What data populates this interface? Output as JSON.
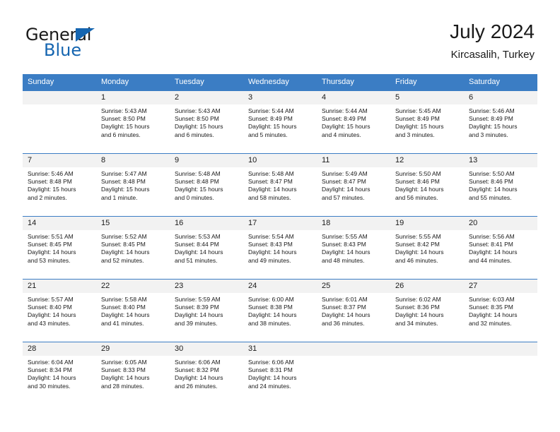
{
  "brand": {
    "word_top": "General",
    "word_bottom": "Blue",
    "triangle_color": "#1565b0",
    "blue_color": "#1565b0"
  },
  "header": {
    "title": "July 2024",
    "subtitle": "Kircasalih, Turkey"
  },
  "theme": {
    "header_bg": "#3b7dc4",
    "header_text": "#ffffff",
    "daynum_bg": "#f2f2f2",
    "row_rule": "#3b7dc4",
    "body_text": "#1a1a1a"
  },
  "weekday_headers": [
    "Sunday",
    "Monday",
    "Tuesday",
    "Wednesday",
    "Thursday",
    "Friday",
    "Saturday"
  ],
  "calendar_data": {
    "type": "table",
    "title": "July 2024",
    "location": "Kircasalih, Turkey",
    "weeks": [
      [
        {
          "day": "",
          "sunrise": "",
          "sunset": "",
          "daylight_line1": "",
          "daylight_line2": ""
        },
        {
          "day": "1",
          "sunrise": "Sunrise: 5:43 AM",
          "sunset": "Sunset: 8:50 PM",
          "daylight_line1": "Daylight: 15 hours",
          "daylight_line2": "and 6 minutes."
        },
        {
          "day": "2",
          "sunrise": "Sunrise: 5:43 AM",
          "sunset": "Sunset: 8:50 PM",
          "daylight_line1": "Daylight: 15 hours",
          "daylight_line2": "and 6 minutes."
        },
        {
          "day": "3",
          "sunrise": "Sunrise: 5:44 AM",
          "sunset": "Sunset: 8:49 PM",
          "daylight_line1": "Daylight: 15 hours",
          "daylight_line2": "and 5 minutes."
        },
        {
          "day": "4",
          "sunrise": "Sunrise: 5:44 AM",
          "sunset": "Sunset: 8:49 PM",
          "daylight_line1": "Daylight: 15 hours",
          "daylight_line2": "and 4 minutes."
        },
        {
          "day": "5",
          "sunrise": "Sunrise: 5:45 AM",
          "sunset": "Sunset: 8:49 PM",
          "daylight_line1": "Daylight: 15 hours",
          "daylight_line2": "and 3 minutes."
        },
        {
          "day": "6",
          "sunrise": "Sunrise: 5:46 AM",
          "sunset": "Sunset: 8:49 PM",
          "daylight_line1": "Daylight: 15 hours",
          "daylight_line2": "and 3 minutes."
        }
      ],
      [
        {
          "day": "7",
          "sunrise": "Sunrise: 5:46 AM",
          "sunset": "Sunset: 8:48 PM",
          "daylight_line1": "Daylight: 15 hours",
          "daylight_line2": "and 2 minutes."
        },
        {
          "day": "8",
          "sunrise": "Sunrise: 5:47 AM",
          "sunset": "Sunset: 8:48 PM",
          "daylight_line1": "Daylight: 15 hours",
          "daylight_line2": "and 1 minute."
        },
        {
          "day": "9",
          "sunrise": "Sunrise: 5:48 AM",
          "sunset": "Sunset: 8:48 PM",
          "daylight_line1": "Daylight: 15 hours",
          "daylight_line2": "and 0 minutes."
        },
        {
          "day": "10",
          "sunrise": "Sunrise: 5:48 AM",
          "sunset": "Sunset: 8:47 PM",
          "daylight_line1": "Daylight: 14 hours",
          "daylight_line2": "and 58 minutes."
        },
        {
          "day": "11",
          "sunrise": "Sunrise: 5:49 AM",
          "sunset": "Sunset: 8:47 PM",
          "daylight_line1": "Daylight: 14 hours",
          "daylight_line2": "and 57 minutes."
        },
        {
          "day": "12",
          "sunrise": "Sunrise: 5:50 AM",
          "sunset": "Sunset: 8:46 PM",
          "daylight_line1": "Daylight: 14 hours",
          "daylight_line2": "and 56 minutes."
        },
        {
          "day": "13",
          "sunrise": "Sunrise: 5:50 AM",
          "sunset": "Sunset: 8:46 PM",
          "daylight_line1": "Daylight: 14 hours",
          "daylight_line2": "and 55 minutes."
        }
      ],
      [
        {
          "day": "14",
          "sunrise": "Sunrise: 5:51 AM",
          "sunset": "Sunset: 8:45 PM",
          "daylight_line1": "Daylight: 14 hours",
          "daylight_line2": "and 53 minutes."
        },
        {
          "day": "15",
          "sunrise": "Sunrise: 5:52 AM",
          "sunset": "Sunset: 8:45 PM",
          "daylight_line1": "Daylight: 14 hours",
          "daylight_line2": "and 52 minutes."
        },
        {
          "day": "16",
          "sunrise": "Sunrise: 5:53 AM",
          "sunset": "Sunset: 8:44 PM",
          "daylight_line1": "Daylight: 14 hours",
          "daylight_line2": "and 51 minutes."
        },
        {
          "day": "17",
          "sunrise": "Sunrise: 5:54 AM",
          "sunset": "Sunset: 8:43 PM",
          "daylight_line1": "Daylight: 14 hours",
          "daylight_line2": "and 49 minutes."
        },
        {
          "day": "18",
          "sunrise": "Sunrise: 5:55 AM",
          "sunset": "Sunset: 8:43 PM",
          "daylight_line1": "Daylight: 14 hours",
          "daylight_line2": "and 48 minutes."
        },
        {
          "day": "19",
          "sunrise": "Sunrise: 5:55 AM",
          "sunset": "Sunset: 8:42 PM",
          "daylight_line1": "Daylight: 14 hours",
          "daylight_line2": "and 46 minutes."
        },
        {
          "day": "20",
          "sunrise": "Sunrise: 5:56 AM",
          "sunset": "Sunset: 8:41 PM",
          "daylight_line1": "Daylight: 14 hours",
          "daylight_line2": "and 44 minutes."
        }
      ],
      [
        {
          "day": "21",
          "sunrise": "Sunrise: 5:57 AM",
          "sunset": "Sunset: 8:40 PM",
          "daylight_line1": "Daylight: 14 hours",
          "daylight_line2": "and 43 minutes."
        },
        {
          "day": "22",
          "sunrise": "Sunrise: 5:58 AM",
          "sunset": "Sunset: 8:40 PM",
          "daylight_line1": "Daylight: 14 hours",
          "daylight_line2": "and 41 minutes."
        },
        {
          "day": "23",
          "sunrise": "Sunrise: 5:59 AM",
          "sunset": "Sunset: 8:39 PM",
          "daylight_line1": "Daylight: 14 hours",
          "daylight_line2": "and 39 minutes."
        },
        {
          "day": "24",
          "sunrise": "Sunrise: 6:00 AM",
          "sunset": "Sunset: 8:38 PM",
          "daylight_line1": "Daylight: 14 hours",
          "daylight_line2": "and 38 minutes."
        },
        {
          "day": "25",
          "sunrise": "Sunrise: 6:01 AM",
          "sunset": "Sunset: 8:37 PM",
          "daylight_line1": "Daylight: 14 hours",
          "daylight_line2": "and 36 minutes."
        },
        {
          "day": "26",
          "sunrise": "Sunrise: 6:02 AM",
          "sunset": "Sunset: 8:36 PM",
          "daylight_line1": "Daylight: 14 hours",
          "daylight_line2": "and 34 minutes."
        },
        {
          "day": "27",
          "sunrise": "Sunrise: 6:03 AM",
          "sunset": "Sunset: 8:35 PM",
          "daylight_line1": "Daylight: 14 hours",
          "daylight_line2": "and 32 minutes."
        }
      ],
      [
        {
          "day": "28",
          "sunrise": "Sunrise: 6:04 AM",
          "sunset": "Sunset: 8:34 PM",
          "daylight_line1": "Daylight: 14 hours",
          "daylight_line2": "and 30 minutes."
        },
        {
          "day": "29",
          "sunrise": "Sunrise: 6:05 AM",
          "sunset": "Sunset: 8:33 PM",
          "daylight_line1": "Daylight: 14 hours",
          "daylight_line2": "and 28 minutes."
        },
        {
          "day": "30",
          "sunrise": "Sunrise: 6:06 AM",
          "sunset": "Sunset: 8:32 PM",
          "daylight_line1": "Daylight: 14 hours",
          "daylight_line2": "and 26 minutes."
        },
        {
          "day": "31",
          "sunrise": "Sunrise: 6:06 AM",
          "sunset": "Sunset: 8:31 PM",
          "daylight_line1": "Daylight: 14 hours",
          "daylight_line2": "and 24 minutes."
        },
        {
          "day": "",
          "sunrise": "",
          "sunset": "",
          "daylight_line1": "",
          "daylight_line2": ""
        },
        {
          "day": "",
          "sunrise": "",
          "sunset": "",
          "daylight_line1": "",
          "daylight_line2": ""
        },
        {
          "day": "",
          "sunrise": "",
          "sunset": "",
          "daylight_line1": "",
          "daylight_line2": ""
        }
      ]
    ]
  }
}
